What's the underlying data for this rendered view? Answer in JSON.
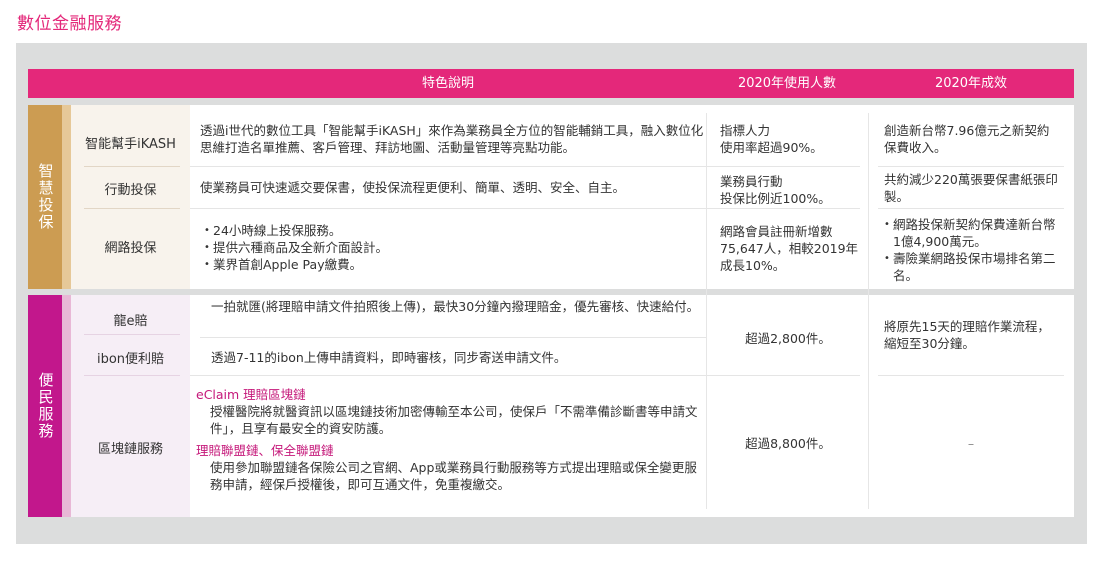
{
  "page": {
    "title": "數位金融服務"
  },
  "colors": {
    "brand_pink": "#e4287a",
    "gold": "#cc9c52",
    "magenta": "#c2178c",
    "panel_gray": "#dcdddd"
  },
  "header": {
    "col_features": "特色說明",
    "col_users": "2020年使用人數",
    "col_results": "2020年成效"
  },
  "categories": {
    "smart": {
      "label": "智慧投保"
    },
    "convenience": {
      "label": "便民服務"
    }
  },
  "rows": {
    "ikash": {
      "name": "智能幫手iKASH",
      "feature": "透過i世代的數位工具「智能幫手iKASH」來作為業務員全方位的智能輔銷工具，融入數位化思維打造名單推薦、客戶管理、拜訪地圖、活動量管理等亮點功能。",
      "users": "指標人力\n使用率超過90%。",
      "result": "創造新台幣7.96億元之新契約保費收入。"
    },
    "mobile": {
      "name": "行動投保",
      "feature": "使業務員可快速遞交要保書，使投保流程更便利、簡單、透明、安全、自主。",
      "users": "業務員行動\n投保比例近100%。",
      "result": "共約減少220萬張要保書紙張印製。"
    },
    "online": {
      "name": "網路投保",
      "features": [
        "24小時線上投保服務。",
        "提供六種商品及全新介面設計。",
        "業界首創Apple Pay繳費。"
      ],
      "users": "網路會員註冊新增數75,647人，相較2019年成長10%。",
      "results": [
        "網路投保新契約保費達新台幣1億4,900萬元。",
        "壽險業網路投保市場排名第二名。"
      ]
    },
    "eclaim_dragon": {
      "name": "龍e賠",
      "feature": "一拍就匯(將理賠申請文件拍照後上傳)，最快30分鐘內撥理賠金，優先審核、快速給付。"
    },
    "ibon": {
      "name": "ibon便利賠",
      "feature": "透過7-11的ibon上傳申請資料，即時審核，同步寄送申請文件。"
    },
    "claims_shared": {
      "users": "超過2,800件。",
      "result": "將原先15天的理賠作業流程，縮短至30分鐘。"
    },
    "blockchain": {
      "name": "區塊鏈服務",
      "heading1": "eClaim 理賠區塊鏈",
      "text1": "授權醫院將就醫資訊以區塊鏈技術加密傳輸至本公司，使保戶「不需準備診斷書等申請文件」，且享有最安全的資安防護。",
      "heading2": "理賠聯盟鏈、保全聯盟鏈",
      "text2": "使用參加聯盟鏈各保險公司之官網、App或業務員行動服務等方式提出理賠或保全變更服務申請，經保戶授權後，即可互通文件，免重複繳交。",
      "users": "超過8,800件。",
      "result": "–"
    }
  }
}
